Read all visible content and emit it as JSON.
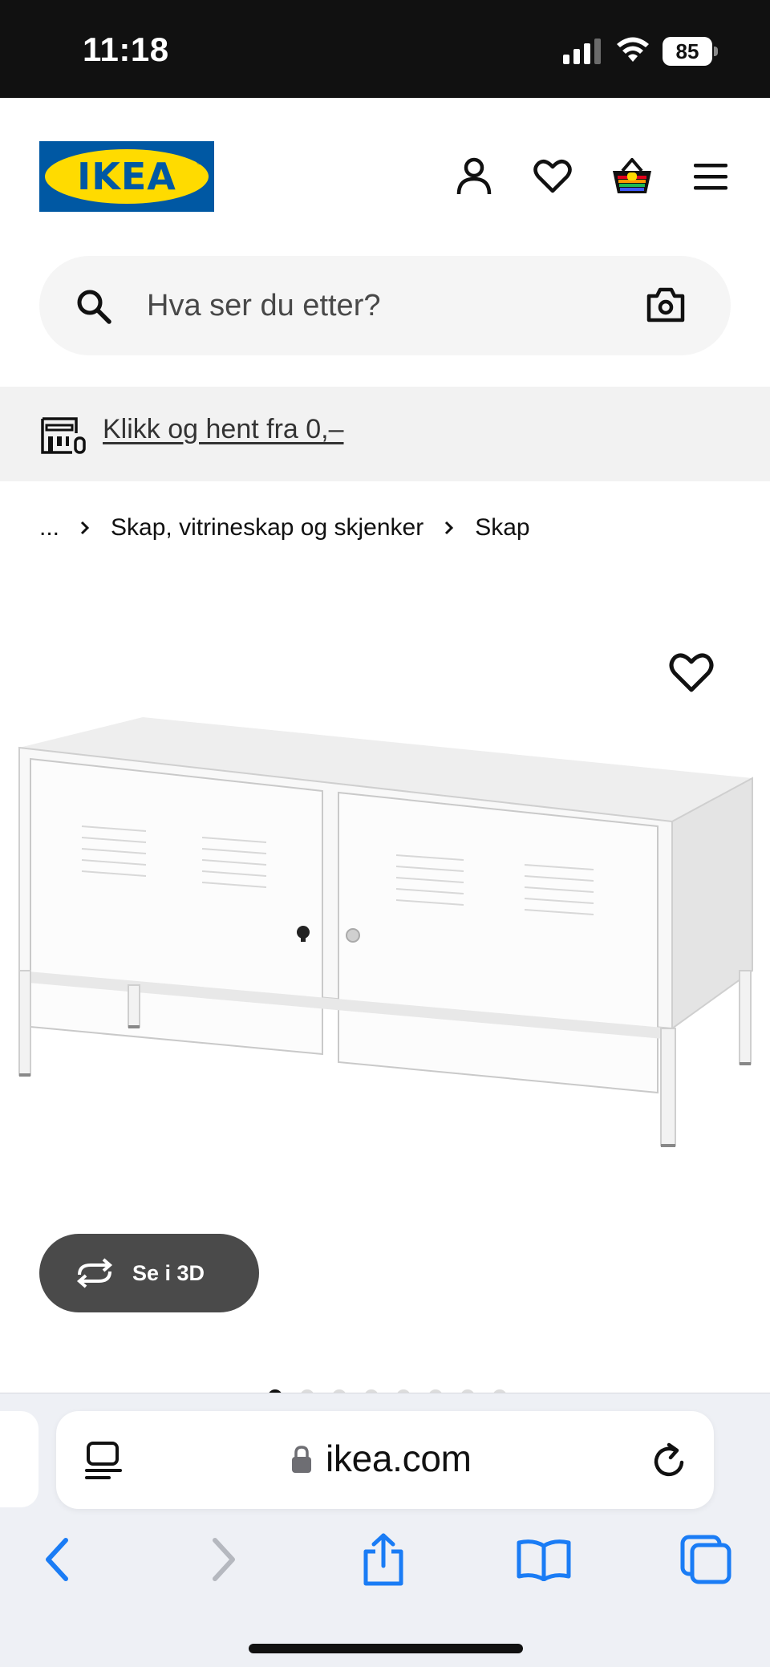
{
  "status_bar": {
    "time": "11:18",
    "battery": "85"
  },
  "header": {
    "logo_text": "IKEA",
    "logo_registered": "®",
    "icons": [
      "profile-icon",
      "heart-icon",
      "basket-icon",
      "menu-icon"
    ],
    "brand_blue": "#0058a3",
    "brand_yellow": "#ffdb00"
  },
  "search": {
    "placeholder": "Hva ser du etter?",
    "value": ""
  },
  "banner": {
    "link_text": "Klikk og hent fra 0,–"
  },
  "breadcrumb": {
    "items": [
      "...",
      "Skap, vitrineskap og skjenker",
      "Skap"
    ]
  },
  "product": {
    "view3d_label": "Se i 3D",
    "gallery": {
      "total_images": 8,
      "active_index": 0
    }
  },
  "browser": {
    "url": "ikea.com",
    "accent": "#1a7cf5"
  }
}
